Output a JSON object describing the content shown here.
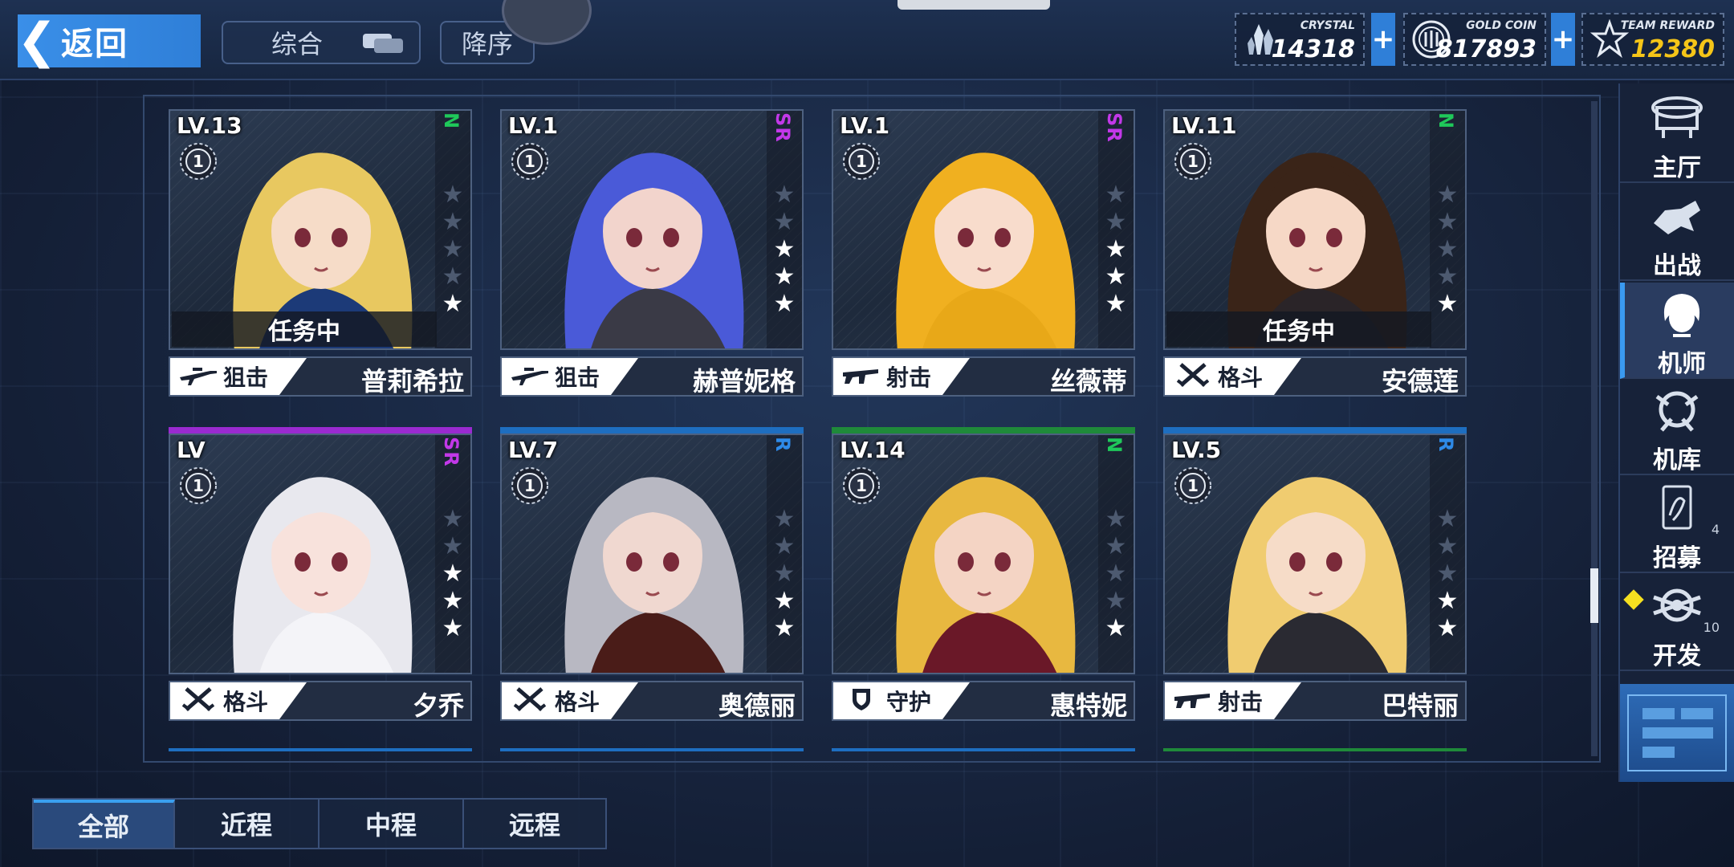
{
  "header": {
    "back_label": "返回",
    "sort_mode": "综合",
    "sort_order": "降序"
  },
  "resources": [
    {
      "caption": "CRYSTAL",
      "value": "14318",
      "icon": "crystal-icon",
      "color": "#ffffff"
    },
    {
      "caption": "GOLD COIN",
      "value": "817893",
      "icon": "gold-coin-icon",
      "color": "#ffffff"
    },
    {
      "caption": "TEAM REWARD",
      "value": "12380",
      "icon": "team-reward-icon",
      "color": "#f5c518"
    }
  ],
  "pilots": [
    {
      "level": "LV.13",
      "badge": "1",
      "rarity": "N",
      "rarity_color": "#1fc85a",
      "stars": 1,
      "status": "任务中",
      "role": "狙击",
      "role_icon": "sniper-rifle-icon",
      "name": "普莉希拉",
      "hair": "#e8c860",
      "skin": "#f6dcc8",
      "outfit": "#1c3a78"
    },
    {
      "level": "LV.1",
      "badge": "1",
      "rarity": "SR",
      "rarity_color": "#c238e8",
      "stars": 3,
      "status": "",
      "role": "狙击",
      "role_icon": "sniper-rifle-icon",
      "name": "赫普妮格",
      "hair": "#4a5ad8",
      "skin": "#f2d4cc",
      "outfit": "#3a3a46"
    },
    {
      "level": "LV.1",
      "badge": "1",
      "rarity": "SR",
      "rarity_color": "#c238e8",
      "stars": 3,
      "status": "",
      "role": "射击",
      "role_icon": "assault-rifle-icon",
      "name": "丝薇蒂",
      "hair": "#f0b020",
      "skin": "#f8dccc",
      "outfit": "#e8a818"
    },
    {
      "level": "LV.11",
      "badge": "1",
      "rarity": "N",
      "rarity_color": "#1fc85a",
      "stars": 1,
      "status": "任务中",
      "role": "格斗",
      "role_icon": "crossed-swords-icon",
      "name": "安德莲",
      "hair": "#3a2418",
      "skin": "#f6d8c6",
      "outfit": "#2a2428"
    },
    {
      "level": "LV",
      "badge": "1",
      "rarity": "SR",
      "rarity_color": "#c238e8",
      "stars": 3,
      "status": "",
      "role": "格斗",
      "role_icon": "crossed-swords-icon",
      "name": "夕乔",
      "hair": "#e8e8ee",
      "skin": "#f8e2dc",
      "outfit": "#f4f4f8",
      "top_color": "#9a2ad0"
    },
    {
      "level": "LV.7",
      "badge": "1",
      "rarity": "R",
      "rarity_color": "#2e8ae8",
      "stars": 2,
      "status": "",
      "role": "格斗",
      "role_icon": "crossed-swords-icon",
      "name": "奥德丽",
      "hair": "#b8b8c2",
      "skin": "#f0d8d0",
      "outfit": "#4a1c18",
      "top_color": "#1e6ec0"
    },
    {
      "level": "LV.14",
      "badge": "1",
      "rarity": "N",
      "rarity_color": "#1fc85a",
      "stars": 1,
      "status": "",
      "role": "守护",
      "role_icon": "shield-icon",
      "name": "惠特妮",
      "hair": "#e8b840",
      "skin": "#f4d4c4",
      "outfit": "#6a1828",
      "top_color": "#1f8a3a"
    },
    {
      "level": "LV.5",
      "badge": "1",
      "rarity": "R",
      "rarity_color": "#2e8ae8",
      "stars": 2,
      "status": "",
      "role": "射击",
      "role_icon": "assault-rifle-icon",
      "name": "巴特丽",
      "hair": "#f0cc70",
      "skin": "#f6dcc8",
      "outfit": "#2a2a32",
      "top_color": "#1e6ec0"
    }
  ],
  "nav": [
    {
      "label": "主厅",
      "icon": "hall-icon",
      "active": false
    },
    {
      "label": "出战",
      "icon": "sortie-icon",
      "active": false
    },
    {
      "label": "机师",
      "icon": "pilot-icon",
      "active": true
    },
    {
      "label": "机库",
      "icon": "hangar-icon",
      "active": false
    },
    {
      "label": "招募",
      "icon": "recruit-card-icon",
      "active": false,
      "count": "4"
    },
    {
      "label": "开发",
      "icon": "develop-icon",
      "active": false,
      "count": "10"
    }
  ],
  "tabs": [
    {
      "label": "全部",
      "active": true
    },
    {
      "label": "近程",
      "active": false
    },
    {
      "label": "中程",
      "active": false
    },
    {
      "label": "远程",
      "active": false
    }
  ]
}
